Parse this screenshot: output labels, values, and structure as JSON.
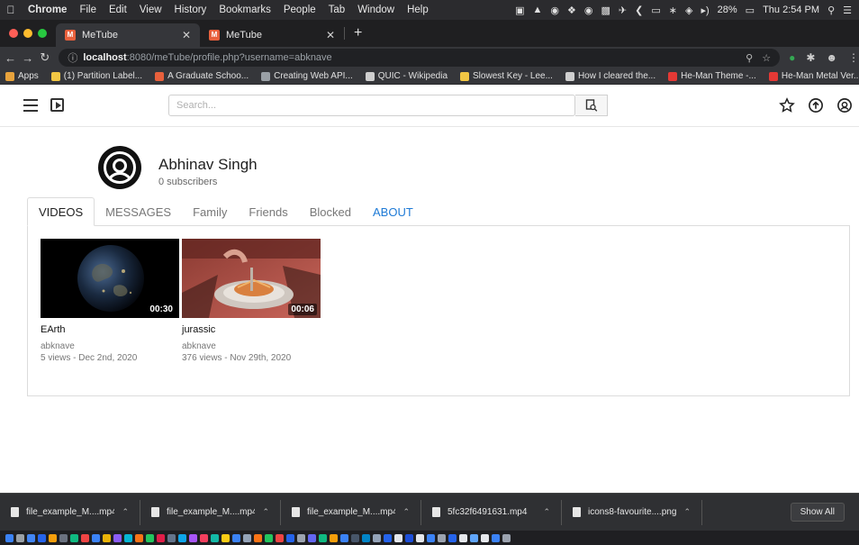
{
  "menubar": {
    "app": "Chrome",
    "items": [
      "File",
      "Edit",
      "View",
      "History",
      "Bookmarks",
      "People",
      "Tab",
      "Window",
      "Help"
    ],
    "battery": "28%",
    "clock": "Thu 2:54 PM"
  },
  "tabs": [
    {
      "title": "MeTube",
      "active": true
    },
    {
      "title": "MeTube",
      "active": false
    }
  ],
  "address": {
    "host": "localhost",
    "path": ":8080/meTube/profile.php?username=abknave"
  },
  "bookmarks": [
    {
      "label": "Apps",
      "color": "#e8a33c"
    },
    {
      "label": "(1) Partition Label...",
      "color": "#f2c744"
    },
    {
      "label": "A Graduate Schoo...",
      "color": "#e8603c"
    },
    {
      "label": "Creating Web API...",
      "color": "#9aa0a6"
    },
    {
      "label": "QUIC - Wikipedia",
      "color": "#cfcfcf"
    },
    {
      "label": "Slowest Key - Lee...",
      "color": "#f2c744"
    },
    {
      "label": "How I cleared the...",
      "color": "#cfcfcf"
    },
    {
      "label": "He-Man Theme -...",
      "color": "#e53935"
    },
    {
      "label": "He-Man Metal Ver...",
      "color": "#e53935"
    }
  ],
  "site": {
    "search_placeholder": "Search...",
    "profile_name": "Abhinav Singh",
    "subscribers": "0 subscribers",
    "tabs": [
      "VIDEOS",
      "MESSAGES",
      "Family",
      "Friends",
      "Blocked",
      "ABOUT"
    ],
    "link_color": "#1e7ad6"
  },
  "videos": [
    {
      "title": "EArth",
      "user": "abknave",
      "meta": "5 views - Dec 2nd, 2020",
      "duration": "00:30"
    },
    {
      "title": "jurassic",
      "user": "abknave",
      "meta": "376 views - Nov 29th, 2020",
      "duration": "00:06"
    }
  ],
  "downloads": {
    "files": [
      "file_example_M....mp4",
      "file_example_M....mp4",
      "file_example_M....mp4",
      "5fc32f6491631.mp4",
      "icons8-favourite....png"
    ],
    "show_all": "Show All"
  }
}
